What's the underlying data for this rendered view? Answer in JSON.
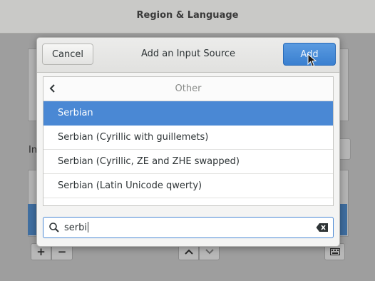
{
  "window": {
    "title": "Region & Language"
  },
  "background": {
    "section_label": "In",
    "add_symbol": "+",
    "remove_symbol": "−",
    "up_symbol": "⌃",
    "down_symbol": "⌄"
  },
  "dialog": {
    "title": "Add an Input Source",
    "cancel_label": "Cancel",
    "add_label": "Add",
    "list_header": "Other",
    "items": [
      {
        "label": "Serbian",
        "selected": true
      },
      {
        "label": "Serbian (Cyrillic with guillemets)",
        "selected": false
      },
      {
        "label": "Serbian (Cyrillic, ZE and ZHE swapped)",
        "selected": false
      },
      {
        "label": "Serbian (Latin Unicode qwerty)",
        "selected": false
      }
    ],
    "search": {
      "value": "serbi"
    }
  },
  "colors": {
    "accent": "#4a88d4",
    "add_button": "#3a80d0"
  }
}
